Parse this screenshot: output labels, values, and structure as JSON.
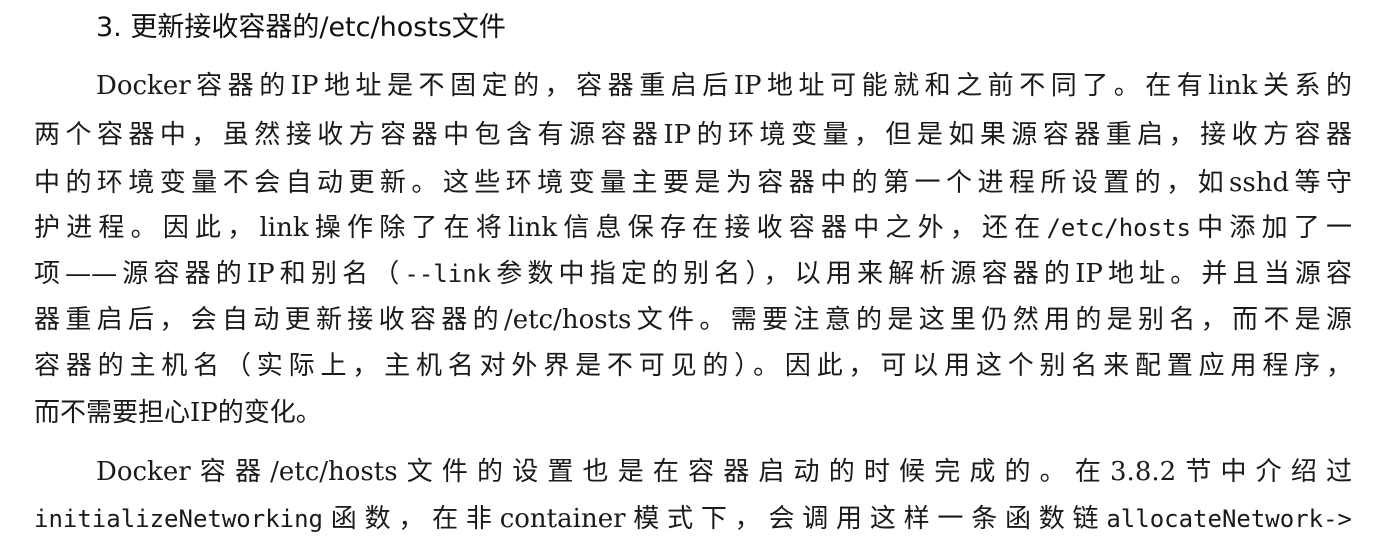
{
  "section": {
    "heading": "3. 更新接收容器的/etc/hosts文件"
  },
  "paragraph1": {
    "line1": "Docker容器的IP地址是不固定的，容器重启后IP地址可能就和之前不同了。在有link关系的",
    "line2": "两个容器中，虽然接收方容器中包含有源容器IP的环境变量，但是如果源容器重启，接收方容器",
    "line3": "中的环境变量不会自动更新。这些环境变量主要是为容器中的第一个进程所设置的，如sshd等守",
    "line4_a": "护进程。因此，link操作除了在将link信息保存在接收容器中之外，还在",
    "line4_code": "/etc/hosts",
    "line4_b": "中添加了一",
    "line5_a": "项——源容器的IP和别名（",
    "line5_code": "--link",
    "line5_b": "参数中指定的别名），以用来解析源容器的IP地址。并且当源容",
    "line6": "器重启后，会自动更新接收容器的/etc/hosts文件。需要注意的是这里仍然用的是别名，而不是源",
    "line7": "容器的主机名（实际上，主机名对外界是不可见的）。因此，可以用这个别名来配置应用程序，",
    "line8": "而不需要担心IP的变化。"
  },
  "paragraph2": {
    "line1": "Docker容器/etc/hosts文件的设置也是在容器启动的时候完成的。在3.8.2节中介绍过",
    "line2_code_a": "initializeNetworking",
    "line2_text": "函数，在非container模式下，会调用这样一条函数链",
    "line2_code_b": "allocateNetwork->"
  }
}
